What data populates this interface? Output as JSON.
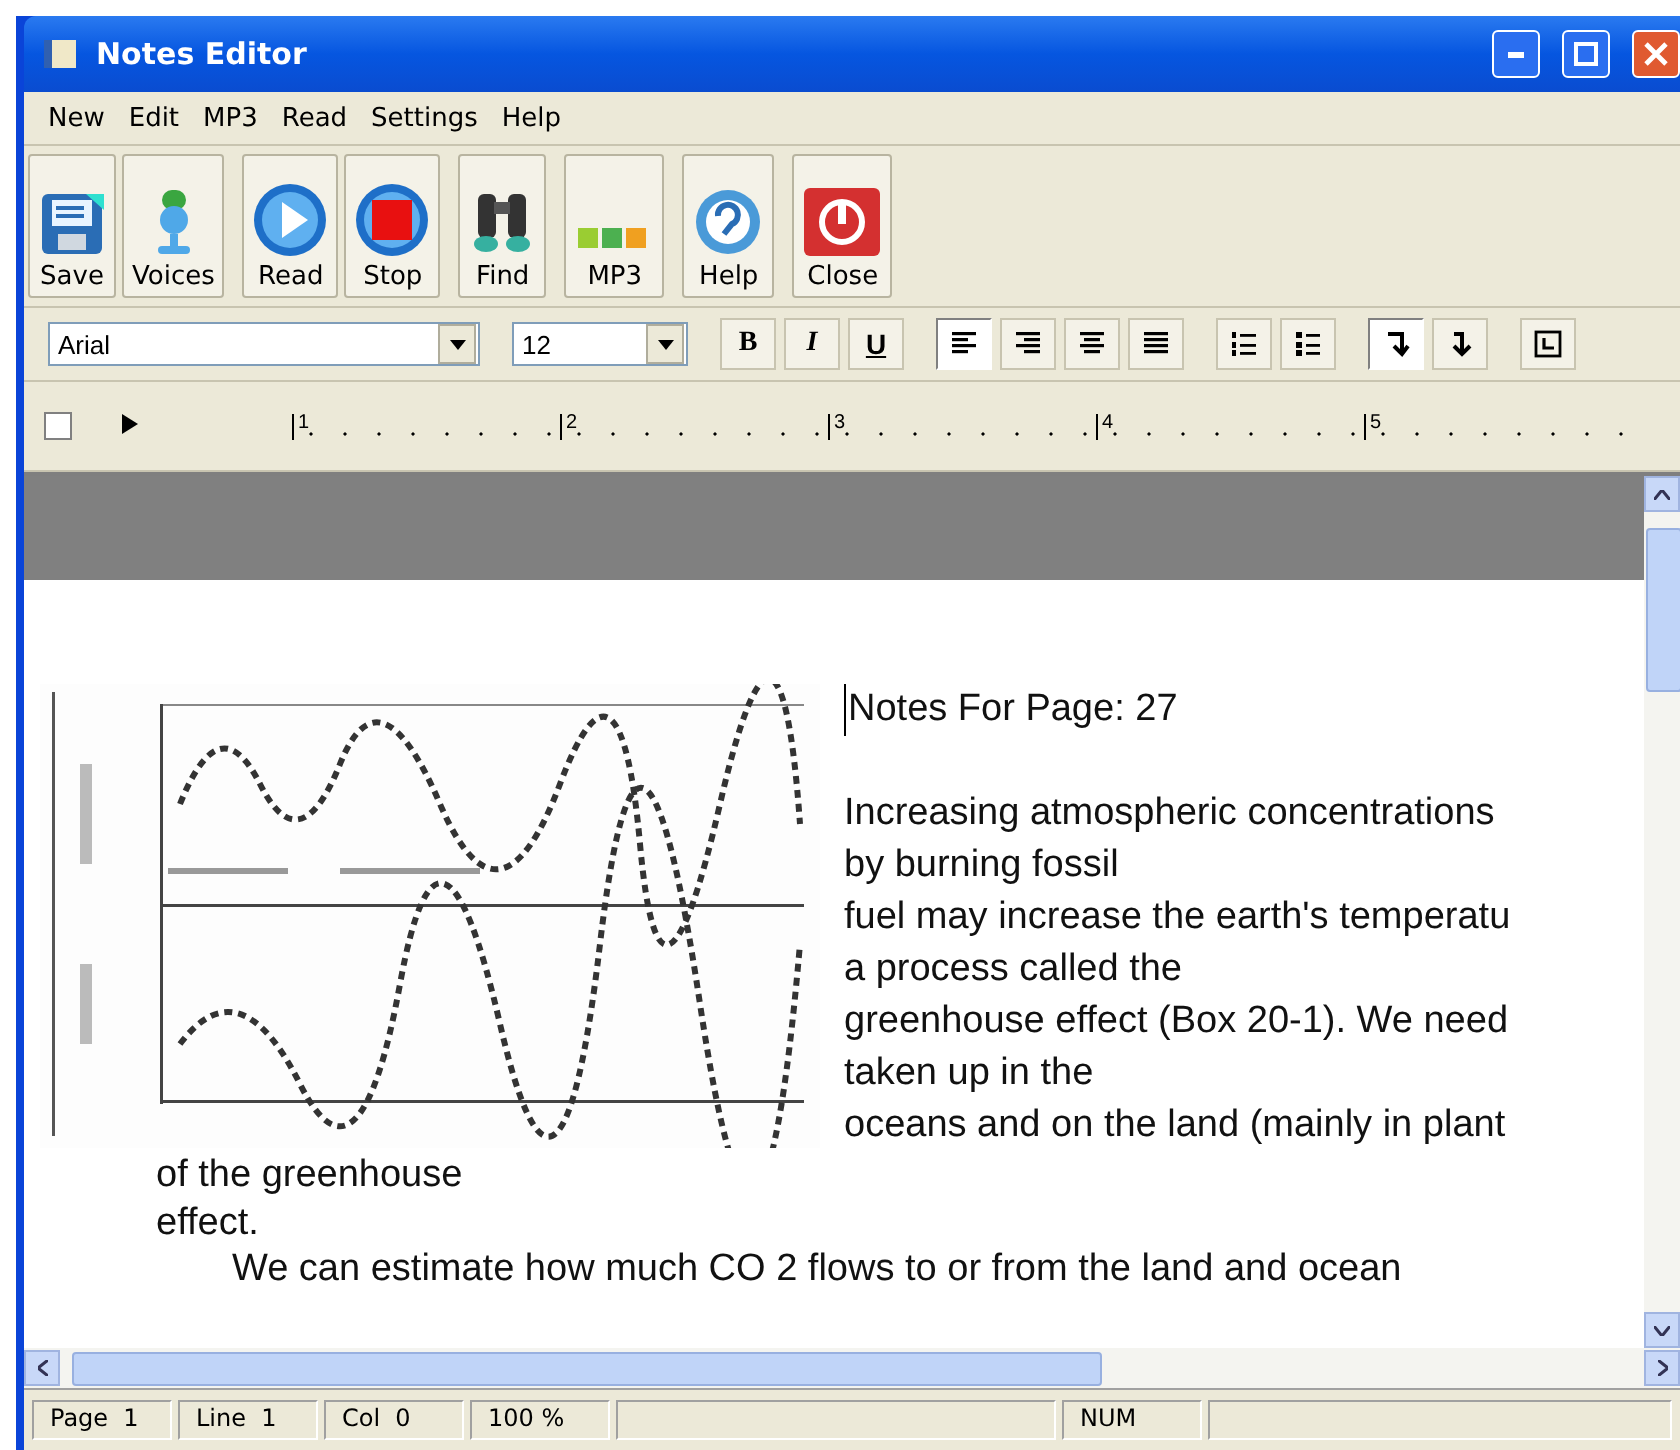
{
  "window": {
    "title": "Notes Editor"
  },
  "menu": [
    "New",
    "Edit",
    "MP3",
    "Read",
    "Settings",
    "Help"
  ],
  "toolbar": [
    {
      "label": "Save",
      "kind": "save"
    },
    {
      "label": "Voices",
      "kind": "voices"
    },
    {
      "label": "Read",
      "kind": "read"
    },
    {
      "label": "Stop",
      "kind": "stop"
    },
    {
      "label": "Find",
      "kind": "find"
    },
    {
      "label": "MP3",
      "kind": "mp3"
    },
    {
      "label": "Help",
      "kind": "help"
    },
    {
      "label": "Close",
      "kind": "close"
    }
  ],
  "format_bar": {
    "font": "Arial",
    "size": "12",
    "buttons": [
      {
        "kind": "bold",
        "label": "B",
        "selected": false
      },
      {
        "kind": "italic",
        "label": "I",
        "selected": false
      },
      {
        "kind": "underline",
        "label": "U",
        "selected": false
      },
      {
        "kind": "align-left",
        "selected": true
      },
      {
        "kind": "align-right",
        "selected": false
      },
      {
        "kind": "align-center",
        "selected": false
      },
      {
        "kind": "justify",
        "selected": false
      },
      {
        "kind": "numbered-list",
        "selected": false
      },
      {
        "kind": "bullet-list",
        "selected": false
      },
      {
        "kind": "indent-first",
        "selected": true
      },
      {
        "kind": "indent-hanging",
        "selected": false
      },
      {
        "kind": "tab-stop",
        "selected": false
      }
    ]
  },
  "ruler": {
    "marks": [
      "1",
      "2",
      "3",
      "4",
      "5"
    ]
  },
  "document": {
    "title": "Notes For Page: 27",
    "side_lines": [
      "Increasing atmospheric concentrations",
      "by burning fossil",
      "fuel may increase the earth's temperatu",
      "a process called the",
      "greenhouse effect (Box 20-1). We need",
      "taken up in the",
      "oceans and on the land (mainly in plant"
    ],
    "lines": [
      "of the greenhouse",
      "effect."
    ],
    "indented_line": "We can estimate how much CO 2 flows to or from the land and ocean"
  },
  "status_bar": [
    "Page  1",
    "Line  1",
    "Col  0",
    "100 %",
    "NUM"
  ]
}
